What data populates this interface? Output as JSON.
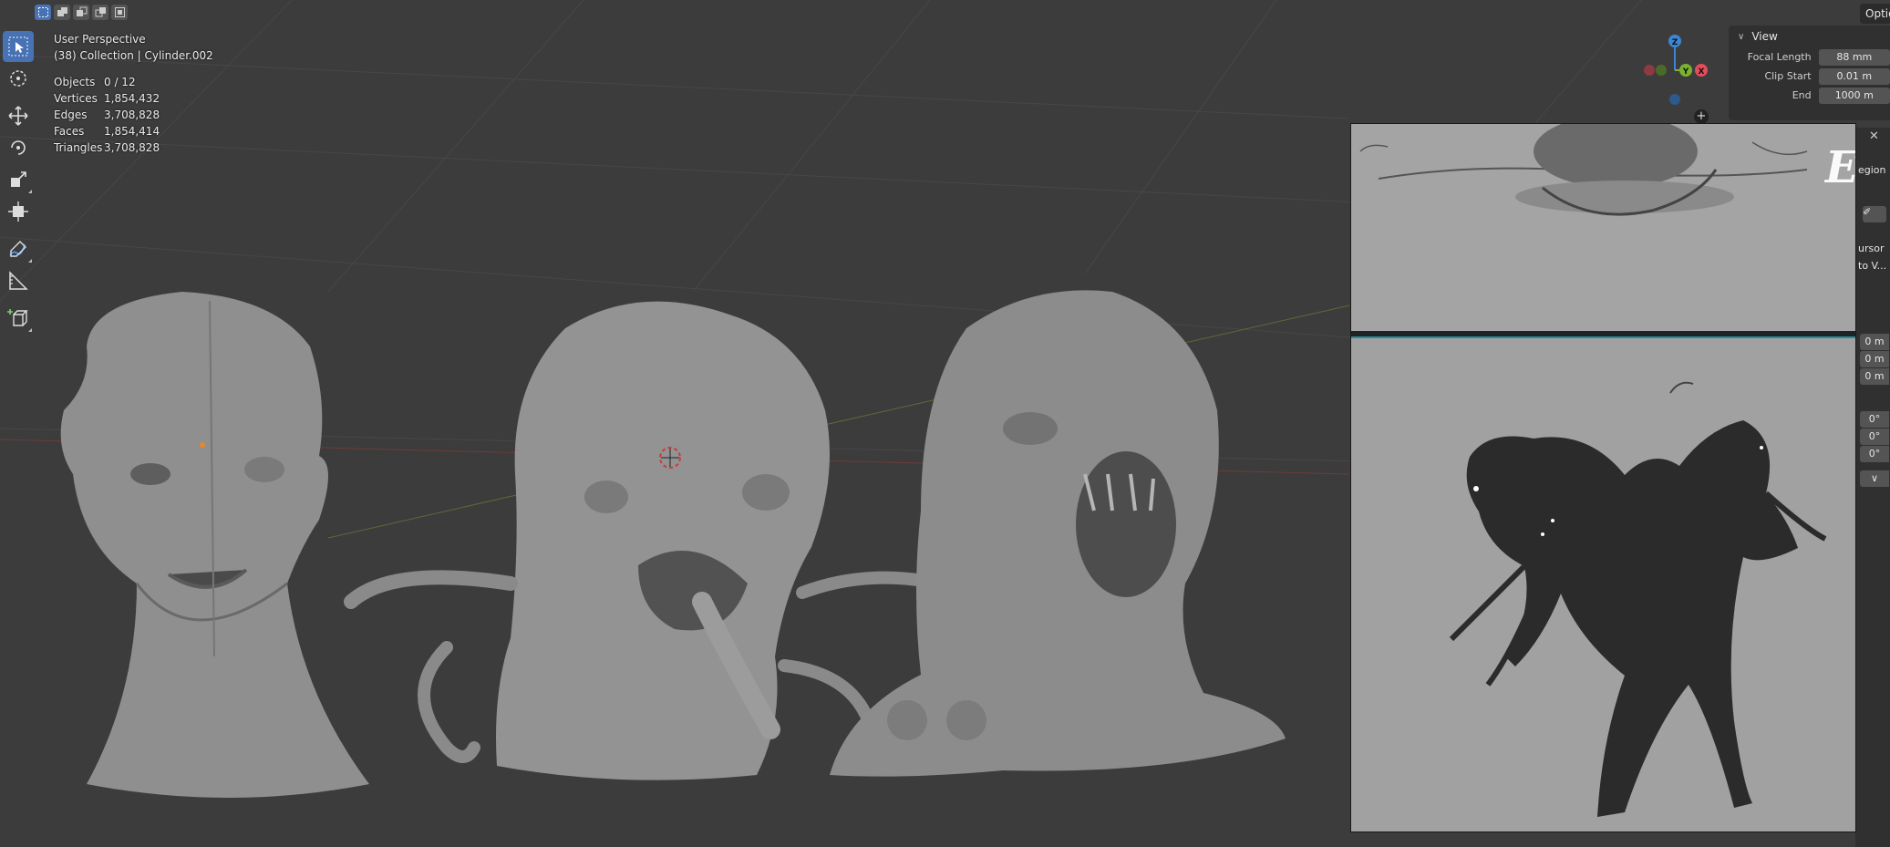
{
  "header": {
    "select_modes": [
      {
        "name": "select-new-icon",
        "active": true
      },
      {
        "name": "select-extend-icon",
        "active": false
      },
      {
        "name": "select-subtract-icon",
        "active": false
      },
      {
        "name": "select-difference-icon",
        "active": false
      },
      {
        "name": "select-intersect-icon",
        "active": false
      }
    ],
    "options_label": "Optio"
  },
  "toolbar": {
    "tools": [
      {
        "name": "select-box-tool",
        "icon": "cursor-arrow-icon",
        "active": true
      },
      {
        "name": "cursor-tool",
        "icon": "3d-cursor-icon",
        "active": false
      },
      {
        "name": "move-tool",
        "icon": "move-arrows-icon",
        "active": false
      },
      {
        "name": "rotate-tool",
        "icon": "rotate-icon",
        "active": false
      },
      {
        "name": "scale-tool",
        "icon": "scale-icon",
        "active": false
      },
      {
        "name": "transform-tool",
        "icon": "transform-icon",
        "active": false
      },
      {
        "name": "annotate-tool",
        "icon": "pencil-icon",
        "active": false
      },
      {
        "name": "measure-tool",
        "icon": "ruler-icon",
        "active": false
      },
      {
        "name": "add-cube-tool",
        "icon": "add-cube-icon",
        "active": false
      }
    ]
  },
  "overlay": {
    "perspective": "User Perspective",
    "collection": "(38) Collection | Cylinder.002"
  },
  "stats": [
    {
      "label": "Objects",
      "value": "0 / 12"
    },
    {
      "label": "Vertices",
      "value": "1,854,432"
    },
    {
      "label": "Edges",
      "value": "3,708,828"
    },
    {
      "label": "Faces",
      "value": "1,854,414"
    },
    {
      "label": "Triangles",
      "value": "3,708,828"
    }
  ],
  "gizmo": {
    "z_label": "Z",
    "y_label": "Y",
    "x_label": "X",
    "colors": {
      "x": "#e54b5a",
      "y": "#7bb32f",
      "z": "#3b86d3"
    }
  },
  "view_panel": {
    "title": "View",
    "focal_length_label": "Focal Length",
    "focal_length_value": "88 mm",
    "clip_start_label": "Clip Start",
    "clip_start_value": "0.01 m",
    "clip_end_label": "End",
    "clip_end_value": "1000 m"
  },
  "side_strip": {
    "text_region": "egion",
    "text_cursor": "ursor",
    "text_to_view": "to V...",
    "loc_values": [
      "0 m",
      "0 m",
      "0 m"
    ],
    "rot_values": [
      "0°",
      "0°",
      "0°"
    ]
  },
  "reference_image": {
    "letter": "E"
  },
  "colors": {
    "accent": "#4772b3",
    "viewport_bg": "#3c3c3c",
    "panel_bg": "#303030",
    "field_bg": "#545454"
  }
}
